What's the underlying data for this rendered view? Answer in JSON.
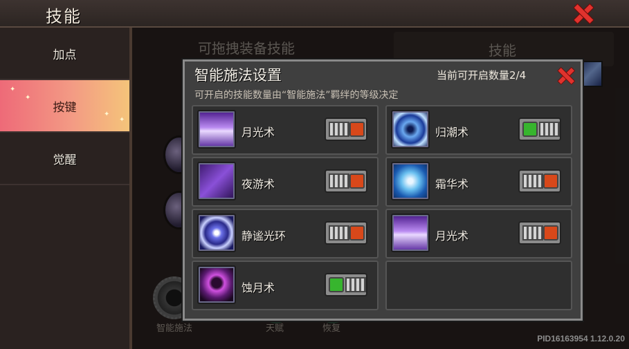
{
  "header": {
    "title": "技能"
  },
  "sidebar": {
    "items": [
      {
        "label": "加点",
        "active": false
      },
      {
        "label": "按键",
        "active": true
      },
      {
        "label": "觉醒",
        "active": false
      }
    ]
  },
  "background": {
    "left_heading": "可拖拽装备技能",
    "right_heading": "技能",
    "bottom_labels": [
      "智能施法",
      "天赋",
      "恢复"
    ]
  },
  "modal": {
    "title": "智能施法设置",
    "count_label": "当前可开启数量2/4",
    "subtitle": "可开启的技能数量由“智能施法”羁绊的等级决定",
    "skills": [
      {
        "name": "月光术",
        "icon": "moonlight-icon",
        "enabled": false
      },
      {
        "name": "归潮术",
        "icon": "tide-icon",
        "enabled": true
      },
      {
        "name": "夜游术",
        "icon": "night-walk-icon",
        "enabled": false
      },
      {
        "name": "霜华术",
        "icon": "frost-icon",
        "enabled": false
      },
      {
        "name": "静谧光环",
        "icon": "serene-aura-icon",
        "enabled": false
      },
      {
        "name": "月光术",
        "icon": "moonlight-icon",
        "enabled": false
      },
      {
        "name": "蚀月术",
        "icon": "eclipse-icon",
        "enabled": true
      }
    ]
  },
  "footer": {
    "version": "PID16163954 1.12.0.20"
  },
  "colors": {
    "toggle_on": "#37b52e",
    "toggle_off": "#d8481a",
    "close_red": "#e0322d",
    "active_tab": "#f39a84"
  }
}
